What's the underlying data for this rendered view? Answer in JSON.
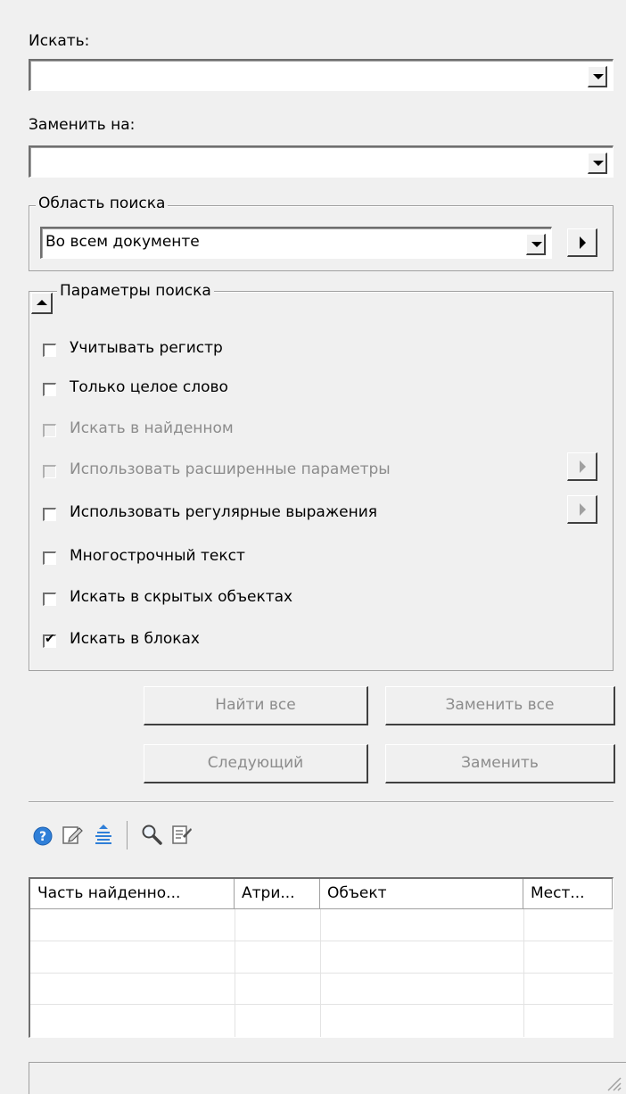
{
  "find": {
    "label": "Искать:",
    "value": ""
  },
  "replace": {
    "label": "Заменить на:",
    "value": ""
  },
  "search_area": {
    "legend": "Область поиска",
    "selected": "Во всем документе"
  },
  "search_params": {
    "legend": "Параметры поиска",
    "options": [
      {
        "label": "Учитывать регистр",
        "checked": false,
        "enabled": true
      },
      {
        "label": "Только целое слово",
        "checked": false,
        "enabled": true
      },
      {
        "label": "Искать в найденном",
        "checked": false,
        "enabled": false
      },
      {
        "label": "Использовать расширенные параметры",
        "checked": false,
        "enabled": false
      },
      {
        "label": "Использовать регулярные выражения",
        "checked": false,
        "enabled": true
      },
      {
        "label": "Многострочный текст",
        "checked": false,
        "enabled": true
      },
      {
        "label": "Искать в скрытых объектах",
        "checked": false,
        "enabled": true
      },
      {
        "label": "Искать в блоках",
        "checked": true,
        "enabled": true
      }
    ]
  },
  "buttons": {
    "find_all": "Найти все",
    "replace_all": "Заменить все",
    "next": "Следующий",
    "replace": "Заменить"
  },
  "toolbar": {
    "icons": [
      "help-icon",
      "edit-icon",
      "align-icon",
      "zoom-icon",
      "export-icon"
    ]
  },
  "results_table": {
    "columns": [
      "Часть найденно...",
      "Атри...",
      "Объект",
      "Мест..."
    ],
    "rows": []
  },
  "status": {
    "text": ""
  }
}
